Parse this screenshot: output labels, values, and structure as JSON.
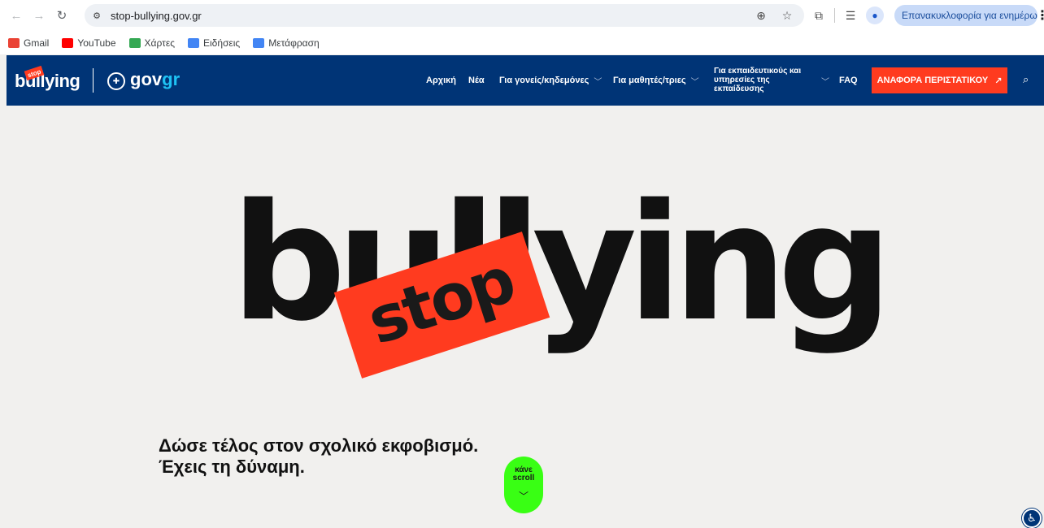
{
  "browser": {
    "url": "stop-bullying.gov.gr",
    "update_label": "Επανακυκλοφορία για ενημέρωση",
    "icons": [
      "back-arrow-icon",
      "forward-arrow-icon",
      "reload-icon",
      "site-info-icon",
      "zoom-icon",
      "star-icon",
      "extensions-icon",
      "reading-list-icon",
      "profile-icon",
      "kebab-menu-icon"
    ]
  },
  "bookmarks": [
    {
      "label": "Gmail",
      "color": "#ea4335"
    },
    {
      "label": "YouTube",
      "color": "#ff0000"
    },
    {
      "label": "Χάρτες",
      "color": "#34a853"
    },
    {
      "label": "Ειδήσεις",
      "color": "#4285f4"
    },
    {
      "label": "Μετάφραση",
      "color": "#4285f4"
    }
  ],
  "header": {
    "logo_text": "bullying",
    "logo_stop": "stop",
    "gov_prefix": "gov",
    "gov_suffix": "gr",
    "nav": {
      "home": "Αρχική",
      "news": "Νέα",
      "parents": "Για γονείς/κηδεμόνες",
      "students": "Για μαθητές/τριες",
      "educators": "Για εκπαιδευτικούς και υπηρεσίες της εκπαίδευσης",
      "faq": "FAQ"
    },
    "report_button": "ΑΝΑΦΟΡΑ ΠΕΡΙΣΤΑΤΙΚΟΥ",
    "colors": {
      "header_bg": "#003476",
      "accent_red": "#ff3b1f",
      "gr_blue": "#1ec2f4"
    }
  },
  "hero": {
    "big_word": "bullying",
    "stop_word": "stop",
    "tagline_line1": "Δώσε τέλος στον σχολικό εκφοβισμό.",
    "tagline_line2": "Έχεις τη δύναμη.",
    "scroll_line1": "κάνε",
    "scroll_line2": "scroll",
    "scroll_color": "#39ff14"
  }
}
